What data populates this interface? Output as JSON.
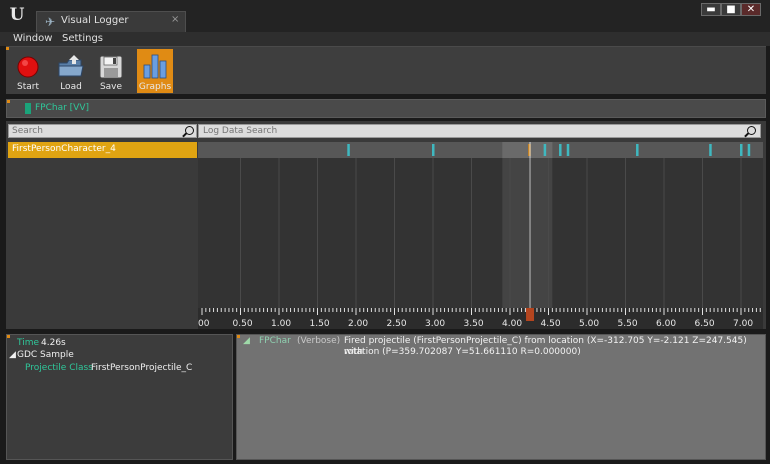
{
  "window": {
    "tab_title": "Visual Logger",
    "tab_close": "×",
    "controls": [
      "▬",
      "■",
      "✕"
    ]
  },
  "menu": [
    "Window",
    "Settings"
  ],
  "toolbar": {
    "buttons": [
      {
        "label": "Start",
        "icon": "record-icon"
      },
      {
        "label": "Load",
        "icon": "load-folder-icon"
      },
      {
        "label": "Save",
        "icon": "floppy-disk-icon"
      },
      {
        "label": "Graphs",
        "icon": "bar-graph-icon",
        "active": true
      }
    ],
    "active_color": "#e08b14"
  },
  "actor_bar": {
    "actor": "FPChar [VV]",
    "chip_color": "#1aa37a"
  },
  "actor_list": {
    "search_placeholder": "Search",
    "items": [
      "FirstPersonCharacter_4"
    ],
    "selected_color": "#e0a412"
  },
  "log_search": {
    "placeholder": "Log Data Search"
  },
  "timeline": {
    "tick_labels": [
      "00",
      "0.50",
      "1.00",
      "1.50",
      "2.00",
      "2.50",
      "3.00",
      "3.50",
      "4.00",
      "4.50",
      "5.00",
      "5.50",
      "6.00",
      "6.50",
      "7.00"
    ],
    "start_time": 0,
    "end_time": 7.25,
    "cursor_time": 4.26,
    "highlight_range": [
      3.9,
      4.55
    ],
    "event_times": [
      1.9,
      3.0,
      4.25,
      4.45,
      4.65,
      4.75,
      5.65,
      6.6,
      7.0,
      7.1
    ],
    "cursor_color": "#e08b14",
    "event_color": "#3fb8c0"
  },
  "details": {
    "time_label": "Time",
    "time_value": "4.26s",
    "category": "GDC Sample",
    "property_name": "Projectile Class",
    "property_value": "FirstPersonProjectile_C"
  },
  "log": {
    "category": "FPChar",
    "verbosity": "(Verbose)",
    "line1": "Fired projectile (FirstPersonProjectile_C) from location (X=-312.705 Y=-2.121 Z=247.545) with",
    "line2": "rotation (P=359.702087 Y=51.661110 R=0.000000)"
  }
}
